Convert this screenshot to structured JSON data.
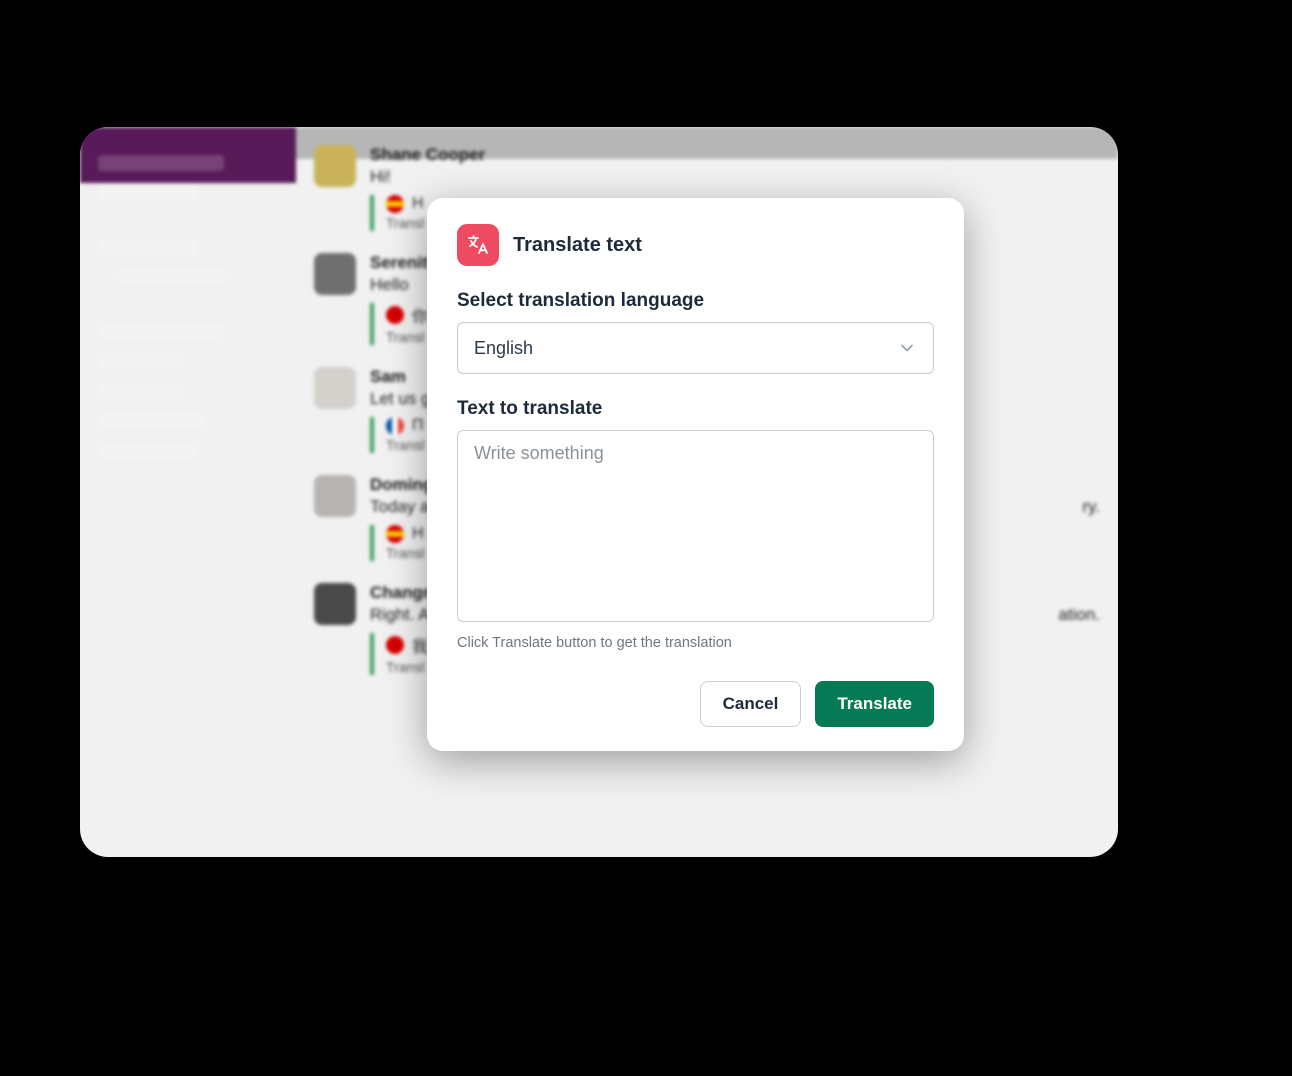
{
  "background": {
    "messages": [
      {
        "name": "Shane Cooper",
        "text": "Hi!",
        "translated_label": "Transl",
        "flag": "es",
        "trans_preview": "H"
      },
      {
        "name": "Serenity",
        "text": "Hello",
        "translated_label": "Transl",
        "flag": "cn",
        "trans_preview": "你"
      },
      {
        "name": "Sam",
        "text": "Let us g",
        "translated_label": "Transl",
        "flag": "fr",
        "trans_preview": "Π"
      },
      {
        "name": "Doming",
        "text": "Today a",
        "tail": "ry.",
        "translated_label": "Transl",
        "flag": "es",
        "trans_preview": "H"
      },
      {
        "name": "Changm",
        "text": "Right. A",
        "tail": "ation.",
        "translated_label": "Transl",
        "flag": "cn",
        "trans_preview": "我"
      }
    ]
  },
  "modal": {
    "title": "Translate text",
    "lang_label": "Select translation language",
    "lang_selected": "English",
    "text_label": "Text to translate",
    "text_placeholder": "Write something",
    "hint": "Click Translate button to get the translation",
    "cancel_label": "Cancel",
    "translate_label": "Translate"
  },
  "colors": {
    "modal_icon_bg": "#ee4b62",
    "primary_button_bg": "#057a55",
    "sidebar_bg": "#581a59"
  }
}
